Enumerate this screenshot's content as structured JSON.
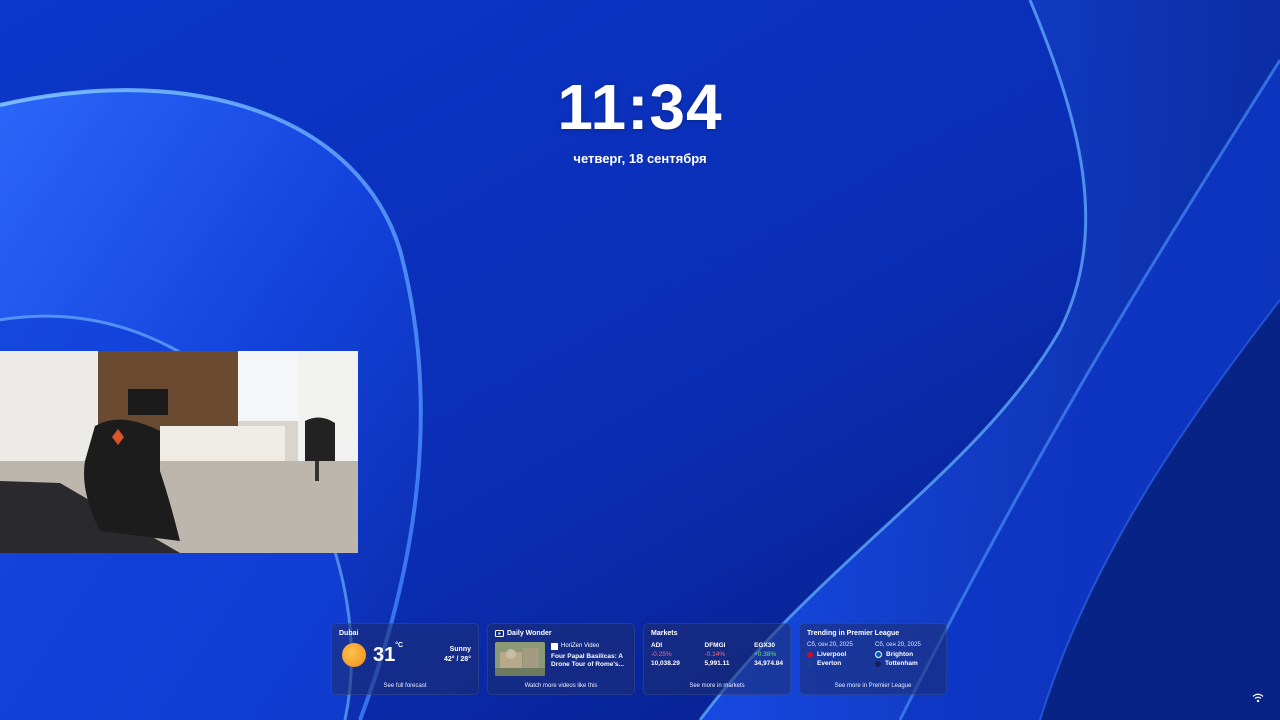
{
  "lock_screen": {
    "time": "11:34",
    "date": "четверг, 18 сентября"
  },
  "widgets": {
    "weather": {
      "title": "Dubai",
      "temperature": "31",
      "unit": "°C",
      "condition": "Sunny",
      "range": "42° / 28°",
      "footer": "See full forecast",
      "icon": "sun-icon"
    },
    "daily_wonder": {
      "title": "Daily Wonder",
      "source": "HoriZen Video",
      "headline": "Four Papal Basilicas: A Drone Tour of Rome's...",
      "footer": "Watch more videos like this",
      "icon": "video-icon"
    },
    "markets": {
      "title": "Markets",
      "items": [
        {
          "name": "ADI",
          "change": "-0.25%",
          "value": "10,038.29",
          "direction": "down"
        },
        {
          "name": "DFMGI",
          "change": "-0.14%",
          "value": "5,991.11",
          "direction": "down"
        },
        {
          "name": "EGX30",
          "change": "+0.38%",
          "value": "34,974.84",
          "direction": "up"
        }
      ],
      "footer": "See more in markets"
    },
    "premier_league": {
      "title": "Trending in Premier League",
      "matches": [
        {
          "date": "Сб, сен 20, 2025",
          "home": "Liverpool",
          "away": "Everton",
          "home_color": "#c8102e",
          "away_color": "#1b3f94"
        },
        {
          "date": "Сб, сен 20, 2025",
          "home": "Brighton",
          "away": "Tottenham",
          "home_color": "#0057b8",
          "away_color": "#132257"
        }
      ],
      "footer": "See more in Premier League"
    }
  },
  "tray": {
    "icon": "wifi-icon"
  },
  "colors": {
    "background": "#0a2fb5",
    "negative": "#ff6b7a",
    "positive": "#6be36b"
  }
}
